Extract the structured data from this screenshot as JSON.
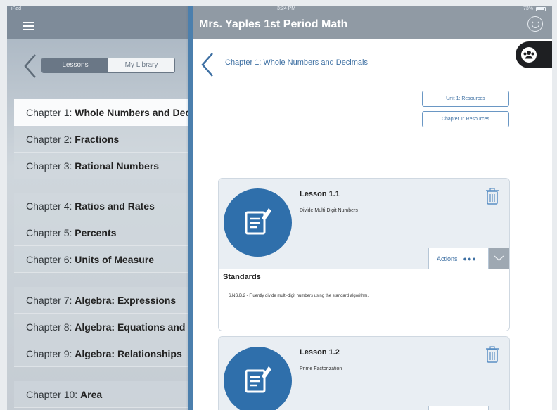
{
  "status": {
    "carrier": "iPad",
    "time": "3:24 PM",
    "battery": "73%"
  },
  "sidebar": {
    "segments": {
      "lessons": "Lessons",
      "library": "My Library"
    },
    "groups": [
      [
        {
          "prefix": "Chapter 1:",
          "title": "Whole Numbers and Decimals",
          "selected": true
        },
        {
          "prefix": "Chapter 2:",
          "title": "Fractions"
        },
        {
          "prefix": "Chapter 3:",
          "title": "Rational Numbers"
        }
      ],
      [
        {
          "prefix": "Chapter 4:",
          "title": "Ratios and Rates"
        },
        {
          "prefix": "Chapter 5:",
          "title": "Percents"
        },
        {
          "prefix": "Chapter 6:",
          "title": "Units of Measure"
        }
      ],
      [
        {
          "prefix": "Chapter 7:",
          "title": "Algebra: Expressions"
        },
        {
          "prefix": "Chapter 8:",
          "title": "Algebra: Equations and Inequalities"
        },
        {
          "prefix": "Chapter 9:",
          "title": "Algebra: Relationships"
        }
      ],
      [
        {
          "prefix": "Chapter 10:",
          "title": "Area"
        }
      ]
    ]
  },
  "header": {
    "title": "Mrs. Yaples 1st Period Math"
  },
  "main": {
    "chapter_title": "Chapter 1: Whole Numbers and Decimals",
    "buttons": {
      "unit_resources": "Unit 1: Resources",
      "chapter_resources": "Chapter 1: Resources"
    },
    "lessons": [
      {
        "title": "Lesson 1.1",
        "subtitle": "Divide Multi-Digit Numbers",
        "actions_label": "Actions",
        "standards_heading": "Standards",
        "standard": "6.NS.B.2 - Fluently divide multi-digit numbers using the standard algorithm."
      },
      {
        "title": "Lesson 1.2",
        "subtitle": "Prime Factorization"
      }
    ]
  },
  "colors": {
    "accent": "#3e70a3",
    "lesson_icon": "#2f6fab",
    "header": "#909aa4"
  }
}
